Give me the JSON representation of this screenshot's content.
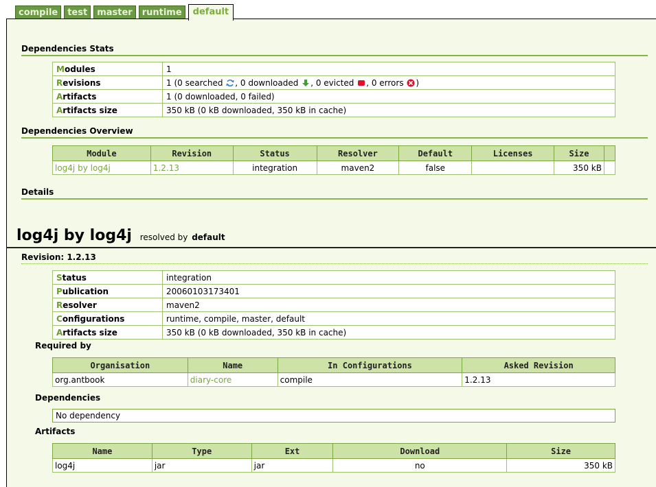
{
  "tabs": [
    {
      "label": "compile",
      "active": false
    },
    {
      "label": "test",
      "active": false
    },
    {
      "label": "master",
      "active": false
    },
    {
      "label": "runtime",
      "active": false
    },
    {
      "label": "default",
      "active": true
    }
  ],
  "stats": {
    "title": "Dependencies Stats",
    "rows": [
      {
        "key_first": "M",
        "key_rest": "odules",
        "value": "1"
      },
      {
        "key_first": "R",
        "key_rest": "evisions",
        "parts": [
          "1 (0 searched ",
          ", 0 downloaded ",
          ", 0 evicted ",
          ", 0 errors ",
          ")"
        ]
      },
      {
        "key_first": "A",
        "key_rest": "rtifacts",
        "value": "1 (0 downloaded, 0 failed)"
      },
      {
        "key_first": "A",
        "key_rest": "rtifacts size",
        "value": "350 kB (0 kB downloaded, 350 kB in cache)"
      }
    ]
  },
  "overview": {
    "title": "Dependencies Overview",
    "headers": [
      "Module",
      "Revision",
      "Status",
      "Resolver",
      "Default",
      "Licenses",
      "Size"
    ],
    "rows": [
      {
        "module": "log4j by log4j",
        "revision": "1.2.13",
        "status": "integration",
        "resolver": "maven2",
        "default": "false",
        "licenses": "",
        "size": "350 kB"
      }
    ]
  },
  "details": {
    "title": "Details",
    "module_name": "log4j by log4j",
    "resolved_by_label": "resolved by",
    "resolver": "default",
    "revision_heading": "Revision: 1.2.13",
    "info_rows": [
      {
        "key_first": "S",
        "key_rest": "tatus",
        "value": "integration"
      },
      {
        "key_first": "P",
        "key_rest": "ublication",
        "value": "20060103173401"
      },
      {
        "key_first": "R",
        "key_rest": "esolver",
        "value": "maven2"
      },
      {
        "key_first": "C",
        "key_rest": "onfigurations",
        "value": "runtime, compile, master, default"
      },
      {
        "key_first": "A",
        "key_rest": "rtifacts size",
        "value": "350 kB (0 kB downloaded, 350 kB in cache)"
      }
    ],
    "required_by": {
      "title": "Required by",
      "headers": [
        "Organisation",
        "Name",
        "In Configurations",
        "Asked Revision"
      ],
      "rows": [
        {
          "organisation": "org.antbook",
          "name": "diary-core",
          "configurations": "compile",
          "asked_revision": "1.2.13"
        }
      ]
    },
    "dependencies": {
      "title": "Dependencies",
      "text": "No dependency"
    },
    "artifacts": {
      "title": "Artifacts",
      "headers": [
        "Name",
        "Type",
        "Ext",
        "Download",
        "Size"
      ],
      "rows": [
        {
          "name": "log4j",
          "type": "jar",
          "ext": "jar",
          "download": "no",
          "size": "350 kB"
        }
      ]
    }
  },
  "icons": {
    "searched": "search-arrows-icon",
    "downloaded": "green-down-arrow-icon",
    "evicted": "red-square-icon",
    "errors": "red-x-circle-icon"
  },
  "colors": {
    "accent_green": "#7aa83f",
    "header_green": "#cde2a6",
    "tab_green": "#6b9a42",
    "background": "#f4fae7",
    "error_red": "#e0102c"
  }
}
